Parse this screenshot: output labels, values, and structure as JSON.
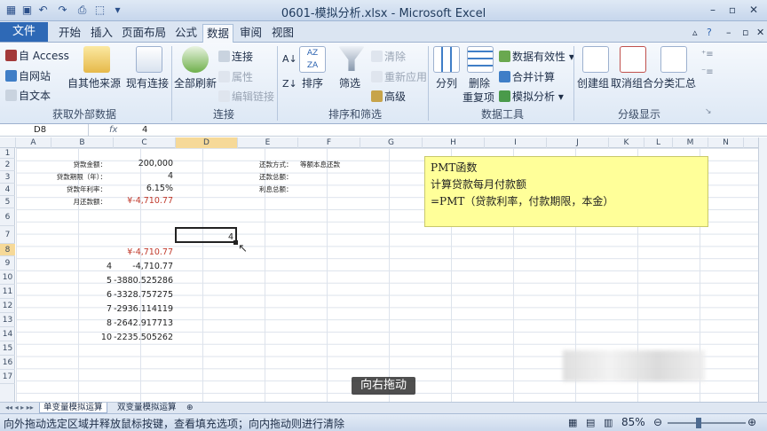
{
  "window": {
    "title": "0601-模拟分析.xlsx - Microsoft Excel"
  },
  "tabs": [
    {
      "label": "文件"
    },
    {
      "label": "开始"
    },
    {
      "label": "插入"
    },
    {
      "label": "页面布局"
    },
    {
      "label": "公式"
    },
    {
      "label": "数据"
    },
    {
      "label": "审阅"
    },
    {
      "label": "视图"
    }
  ],
  "ribbon": {
    "get_external": {
      "access": "自 Access",
      "web": "自网站",
      "text": "自文本",
      "other": "自其他来源",
      "existing": "现有连接",
      "label": "获取外部数据"
    },
    "connections": {
      "refresh_all": "全部刷新",
      "connections": "连接",
      "properties": "属性",
      "edit_links": "编辑链接",
      "label": "连接"
    },
    "sort_filter": {
      "sort": "排序",
      "filter": "筛选",
      "clear": "清除",
      "reapply": "重新应用",
      "advanced": "高级",
      "label": "排序和筛选"
    },
    "data_tools": {
      "text_to_columns": "分列",
      "remove_dup_1": "删除",
      "remove_dup_2": "重复项",
      "validation": "数据有效性",
      "consolidate": "合并计算",
      "what_if": "模拟分析",
      "label": "数据工具"
    },
    "outline": {
      "group": "创建组",
      "ungroup": "取消组合",
      "subtotal": "分类汇总",
      "label": "分级显示"
    }
  },
  "formula_bar": {
    "name_box": "D8",
    "fx": "fx",
    "value": "4"
  },
  "columns": [
    "A",
    "B",
    "C",
    "D",
    "E",
    "F",
    "G",
    "H",
    "I",
    "J",
    "K",
    "L",
    "M",
    "N"
  ],
  "rows": [
    "1",
    "2",
    "3",
    "4",
    "5",
    "6",
    "7",
    "8",
    "9",
    "10",
    "11",
    "12",
    "13",
    "14",
    "15",
    "16",
    "17"
  ],
  "cells": {
    "B2": "贷款金额：",
    "C2": "200,000",
    "B3": "贷款期限（年）：",
    "C3": "4",
    "B4": "贷款年利率：",
    "C4": "6.15%",
    "B5": "月还款额：",
    "C5": "¥-4,710.77",
    "E2": "还款方式：",
    "F2": "等额本息还款",
    "E3": "还款总额：",
    "E4": "利息总额：",
    "D8": "4",
    "C9": "¥-4,710.77",
    "B10": "4",
    "C10": "-4,710.77",
    "B11": "5",
    "C11": "-3880.525286",
    "B12": "6",
    "C12": "-3328.757275",
    "B13": "7",
    "C13": "-2936.114119",
    "B14": "8",
    "C14": "-2642.917713",
    "B15": "10",
    "C15": "-2235.505262"
  },
  "note": {
    "line1": "PMT函数",
    "line2": "计算贷款每月付款额",
    "line3": "=PMT（贷款利率，付款期限，本金）"
  },
  "sheets": [
    {
      "label": "单变量模拟运算"
    },
    {
      "label": "双变量模拟运算"
    }
  ],
  "status": {
    "message": "向外拖动选定区域并释放鼠标按键，查看填充选项；向内拖动则进行清除",
    "zoom": "85%"
  },
  "caption": "向右拖动",
  "colors": {
    "accent": "#2e69b6",
    "note_bg": "#ffff99",
    "red": "#c0392b",
    "selected_header": "#f6d998"
  }
}
